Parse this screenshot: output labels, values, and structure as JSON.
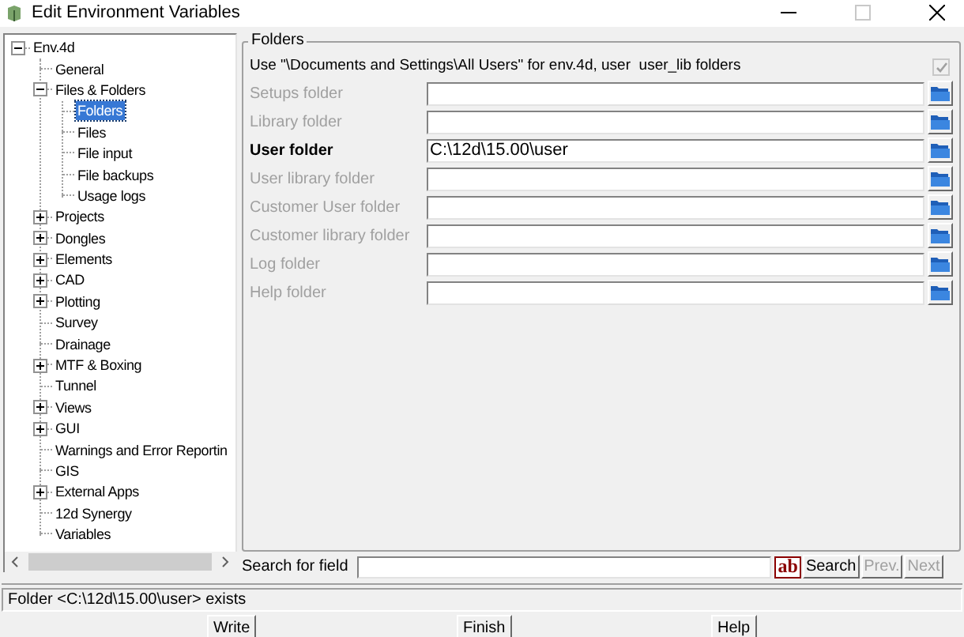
{
  "window": {
    "title": "Edit Environment Variables"
  },
  "tree": [
    {
      "label": "Env.4d",
      "expanded": true,
      "selected": false,
      "children": [
        {
          "label": "General",
          "selected": false
        },
        {
          "label": "Files & Folders",
          "expanded": true,
          "selected": false,
          "children": [
            {
              "label": "Folders",
              "selected": true
            },
            {
              "label": "Files",
              "selected": false
            },
            {
              "label": "File input",
              "selected": false
            },
            {
              "label": "File backups",
              "selected": false
            },
            {
              "label": "Usage logs",
              "selected": false
            }
          ]
        },
        {
          "label": "Projects",
          "expanded": false,
          "selected": false
        },
        {
          "label": "Dongles",
          "expanded": false,
          "selected": false
        },
        {
          "label": "Elements",
          "expanded": false,
          "selected": false
        },
        {
          "label": "CAD",
          "expanded": false,
          "selected": false
        },
        {
          "label": "Plotting",
          "expanded": false,
          "selected": false
        },
        {
          "label": "Survey",
          "selected": false
        },
        {
          "label": "Drainage",
          "selected": false
        },
        {
          "label": "MTF & Boxing",
          "expanded": false,
          "selected": false
        },
        {
          "label": "Tunnel",
          "selected": false
        },
        {
          "label": "Views",
          "expanded": false,
          "selected": false
        },
        {
          "label": "GUI",
          "expanded": false,
          "selected": false
        },
        {
          "label": "Warnings and Error Reportin",
          "selected": false
        },
        {
          "label": "GIS",
          "selected": false
        },
        {
          "label": "External Apps",
          "expanded": false,
          "selected": false
        },
        {
          "label": "12d Synergy",
          "selected": false
        },
        {
          "label": "Variables",
          "selected": false
        }
      ]
    }
  ],
  "group": {
    "title": "Folders",
    "option": {
      "label": "Use \"\\Documents and Settings\\All Users\" for env.4d, user  user_lib folders",
      "checked": true,
      "disabled": true
    },
    "fields": [
      {
        "label": "Setups folder",
        "disabled": true
      },
      {
        "label": "Library folder",
        "disabled": true
      },
      {
        "label": "User folder",
        "value": "C:\\12d\\15.00\\user",
        "disabled": false
      },
      {
        "label": "User library folder",
        "disabled": true
      },
      {
        "label": "Customer User folder",
        "disabled": true
      },
      {
        "label": "Customer library folder",
        "disabled": true
      },
      {
        "label": "Log folder",
        "disabled": true
      },
      {
        "label": "Help folder",
        "disabled": true
      }
    ]
  },
  "search": {
    "label": "Search for field",
    "case_button": "ab",
    "buttons": [
      {
        "label": "Search",
        "disabled": false
      },
      {
        "label": "Prev.",
        "disabled": true
      },
      {
        "label": "Next",
        "disabled": true
      }
    ]
  },
  "status": "Folder <C:\\12d\\15.00\\user> exists",
  "buttons": [
    "Write",
    "Finish",
    "Help"
  ]
}
